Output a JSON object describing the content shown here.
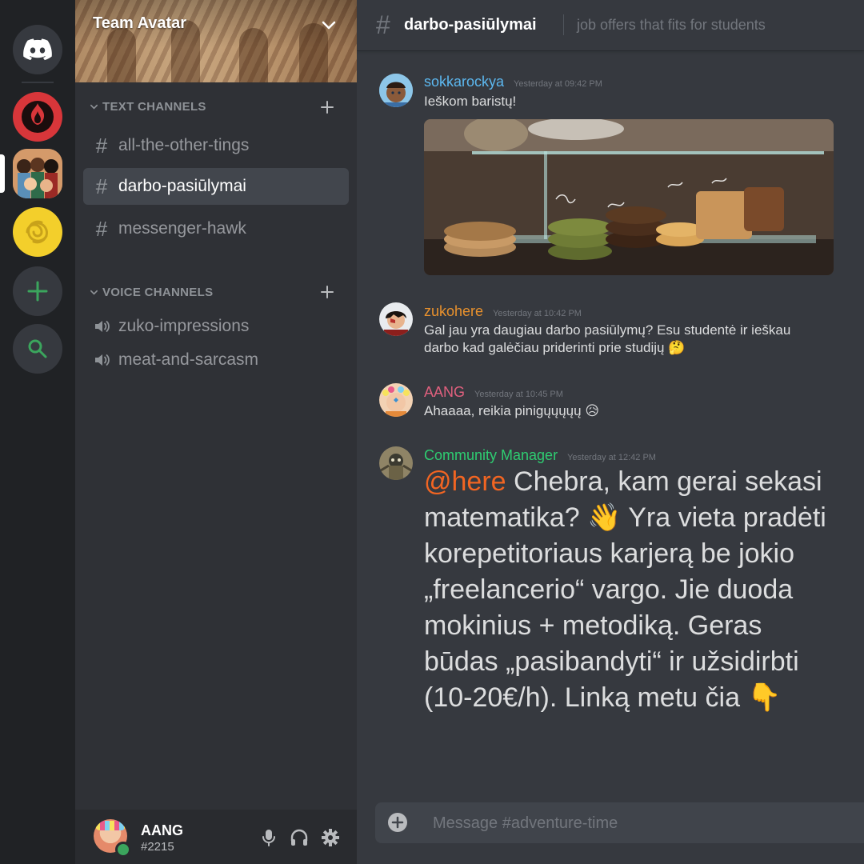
{
  "server": {
    "name": "Team Avatar",
    "text_channels_label": "TEXT CHANNELS",
    "voice_channels_label": "VOICE CHANNELS",
    "text_channels": [
      {
        "name": "all-the-other-tings",
        "active": false
      },
      {
        "name": "darbo-pasiūlymai",
        "active": true
      },
      {
        "name": "messenger-hawk",
        "active": false
      }
    ],
    "voice_channels": [
      {
        "name": "zuko-impressions"
      },
      {
        "name": "meat-and-sarcasm"
      }
    ]
  },
  "channel": {
    "name": "darbo-pasiūlymai",
    "topic": "job offers that fits for students"
  },
  "messages": [
    {
      "author": "sokkarockya",
      "author_color": "#5cb8f0",
      "timestamp": "Yesterday at 09:42 PM",
      "text": "Ieškom baristų!",
      "has_image": true
    },
    {
      "author": "zukohere",
      "author_color": "#e8912d",
      "timestamp": "Yesterday at 10:42 PM",
      "text": "Gal jau yra daugiau darbo pasiūlymų? Esu studentė ir ieškau darbo kad galėčiau priderinti prie studijų 🤔"
    },
    {
      "author": "AANG",
      "author_color": "#e0607e",
      "timestamp": "Yesterday at 10:45 PM",
      "text": "Ahaaaa, reikia pinigųųųųų 😥"
    },
    {
      "author": "Community Manager",
      "author_color": "#2ecc71",
      "timestamp": "Yesterday at 12:42 PM",
      "mention": "@here",
      "text": " Chebra, kam gerai sekasi matematika? 👋 Yra vieta pradėti korepetitoriaus karjerą be jokio „freelancerio“ vargo. Jie duoda mokinius + metodiką. Geras būdas „pasibandyti“ ir užsidirbti (10-20€/h). Linką metu čia 👇"
    }
  ],
  "composer": {
    "placeholder": "Message #adventure-time"
  },
  "user": {
    "name": "AANG",
    "tag": "#2215",
    "status": "online"
  },
  "icons": {
    "home": "discord-logo-icon",
    "add_server": "plus-icon",
    "explore": "search-icon",
    "mic": "microphone-icon",
    "headphones": "headphones-icon",
    "settings": "gear-icon"
  },
  "colors": {
    "accent_green": "#3ba55d",
    "mention": "#f26522"
  }
}
